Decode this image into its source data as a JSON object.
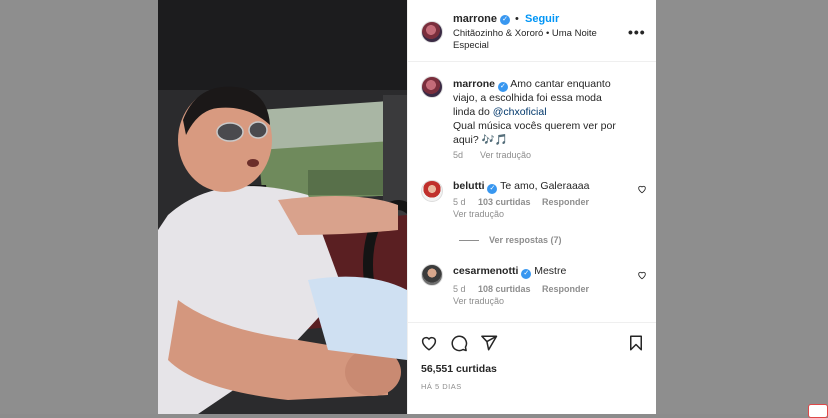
{
  "post": {
    "username": "marrone",
    "follow_label": "Seguir",
    "dot": "•",
    "audio_subtitle": "Chitãozinho & Xororó • Uma Noite Especial",
    "more_label": "•••"
  },
  "caption": {
    "username": "marrone",
    "text_line1": "Amo cantar enquanto",
    "text_line2": "viajo, a escolhida foi essa moda",
    "text_line3_prefix": "linda do ",
    "mention": "@chxoficial",
    "text_line4": "Qual música vocês querem ver por",
    "text_line5": "aqui? 🎶🎵",
    "time": "5d",
    "translate": "Ver tradução"
  },
  "comments": [
    {
      "username": "belutti",
      "text": "Te amo, Galeraaaa",
      "time": "5 d",
      "likes": "103 curtidas",
      "reply": "Responder",
      "translate": "Ver tradução"
    },
    {
      "username": "cesarmenotti",
      "text": "Mestre",
      "time": "5 d",
      "likes": "108 curtidas",
      "reply": "Responder",
      "translate": "Ver tradução"
    }
  ],
  "view_replies": "Ver respostas (7)",
  "footer": {
    "likes_count": "56,551 curtidas",
    "posted_ago": "HÁ 5 DIAS"
  },
  "icons": {
    "like": "heart-icon",
    "comment": "comment-icon",
    "share": "share-icon",
    "save": "bookmark-icon",
    "more": "more-options-icon"
  },
  "colors": {
    "accent": "#0095f6",
    "verified": "#3897f0",
    "text": "#262626",
    "muted": "#8e8e8e"
  }
}
